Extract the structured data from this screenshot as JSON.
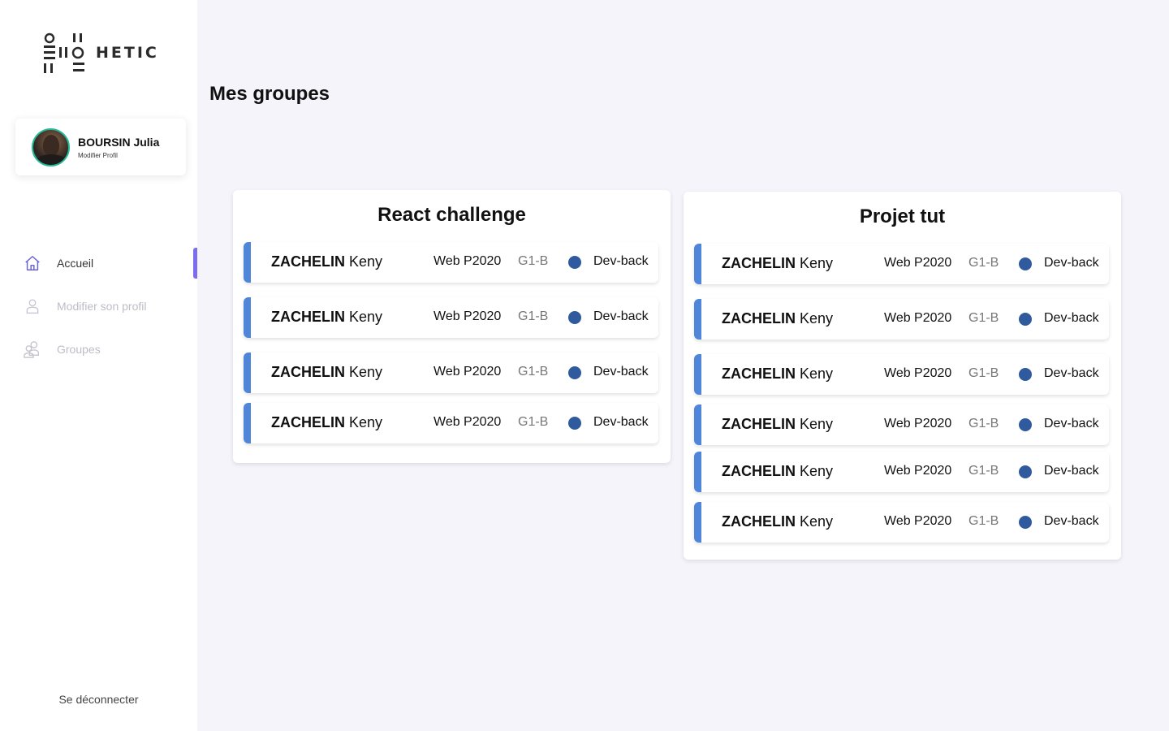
{
  "brand": {
    "name": "HETIC"
  },
  "profile": {
    "name": "BOURSIN Julia",
    "subtitle": "Modifier Profil"
  },
  "nav": {
    "items": [
      {
        "label": "Accueil",
        "icon": "home-icon",
        "active": true
      },
      {
        "label": "Modifier son profil",
        "icon": "user-icon",
        "active": false
      },
      {
        "label": "Groupes",
        "icon": "users-icon",
        "active": false
      }
    ],
    "logout_label": "Se déconnecter"
  },
  "page": {
    "title": "Mes groupes"
  },
  "colors": {
    "accent": "#4f86d9",
    "active_indicator": "#7b6cf0",
    "status_dot": "#2f5a9e",
    "avatar_ring": "#23b996"
  },
  "groups": [
    {
      "title": "React challenge",
      "members": [
        {
          "last": "ZACHELIN",
          "first": "Keny",
          "promo": "Web P2020",
          "group": "G1-B",
          "role": "Dev-back"
        },
        {
          "last": "ZACHELIN",
          "first": "Keny",
          "promo": "Web P2020",
          "group": "G1-B",
          "role": "Dev-back"
        },
        {
          "last": "ZACHELIN",
          "first": "Keny",
          "promo": "Web P2020",
          "group": "G1-B",
          "role": "Dev-back"
        },
        {
          "last": "ZACHELIN",
          "first": "Keny",
          "promo": "Web P2020",
          "group": "G1-B",
          "role": "Dev-back"
        }
      ]
    },
    {
      "title": "Projet tut",
      "members": [
        {
          "last": "ZACHELIN",
          "first": "Keny",
          "promo": "Web P2020",
          "group": "G1-B",
          "role": "Dev-back"
        },
        {
          "last": "ZACHELIN",
          "first": "Keny",
          "promo": "Web P2020",
          "group": "G1-B",
          "role": "Dev-back"
        },
        {
          "last": "ZACHELIN",
          "first": "Keny",
          "promo": "Web P2020",
          "group": "G1-B",
          "role": "Dev-back"
        },
        {
          "last": "ZACHELIN",
          "first": "Keny",
          "promo": "Web P2020",
          "group": "G1-B",
          "role": "Dev-back"
        },
        {
          "last": "ZACHELIN",
          "first": "Keny",
          "promo": "Web P2020",
          "group": "G1-B",
          "role": "Dev-back"
        },
        {
          "last": "ZACHELIN",
          "first": "Keny",
          "promo": "Web P2020",
          "group": "G1-B",
          "role": "Dev-back"
        }
      ]
    }
  ]
}
